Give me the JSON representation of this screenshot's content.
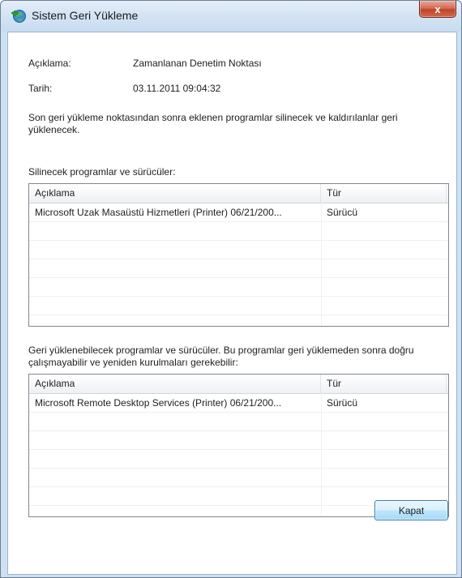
{
  "window": {
    "title": "Sistem Geri Yükleme",
    "close_label": "x"
  },
  "info": {
    "description_label": "Açıklama:",
    "description_value": "Zamanlanan Denetim Noktası",
    "date_label": "Tarih:",
    "date_value": "03.11.2011 09:04:32",
    "summary": "Son geri yükleme noktasından sonra eklenen programlar silinecek ve kaldırılanlar geri yüklenecek."
  },
  "deleted_section": {
    "heading": "Silinecek programlar ve sürücüler:",
    "columns": [
      "Açıklama",
      "Tür"
    ],
    "rows": [
      [
        "Microsoft Uzak Masaüstü Hizmetleri (Printer) 06/21/200...",
        "Sürücü"
      ]
    ]
  },
  "restored_section": {
    "heading": "Geri yüklenebilecek programlar ve sürücüler. Bu programlar geri yüklemeden sonra doğru çalışmayabilir ve yeniden kurulmaları gerekebilir:",
    "columns": [
      "Açıklama",
      "Tür"
    ],
    "rows": [
      [
        "Microsoft Remote Desktop Services (Printer) 06/21/200...",
        "Sürücü"
      ]
    ]
  },
  "buttons": {
    "close": "Kapat"
  }
}
